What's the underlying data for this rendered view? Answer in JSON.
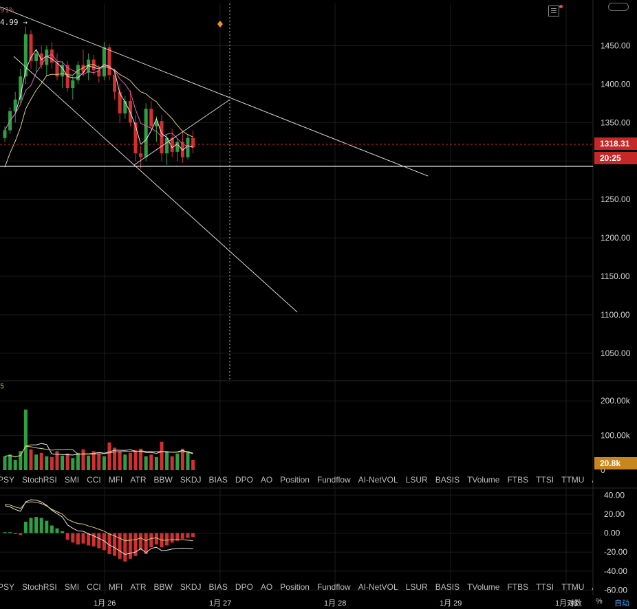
{
  "chart_data": [
    {
      "type": "candlestick",
      "panel": "price",
      "ylim": [
        1015,
        1505
      ],
      "y_ticks": [
        "1450.00",
        "1400.00",
        "1350.00",
        "1300.00",
        "1250.00",
        "1200.00",
        "1150.00",
        "1100.00",
        "1050.00"
      ],
      "y_tick_values": [
        1450,
        1400,
        1350,
        1300,
        1250,
        1200,
        1150,
        1100,
        1050
      ],
      "x_ticks": [
        "1月 26",
        "1月 27",
        "1月 28",
        "1月 29",
        "1月 30"
      ],
      "last_price": "1318.31",
      "countdown": "20:25",
      "top_left_pct": "91%",
      "top_left_price": "4.99 →",
      "candles": [
        [
          1330,
          1345,
          1325,
          1340
        ],
        [
          1340,
          1370,
          1335,
          1365
        ],
        [
          1365,
          1390,
          1350,
          1380
        ],
        [
          1380,
          1420,
          1375,
          1410
        ],
        [
          1410,
          1475,
          1400,
          1465
        ],
        [
          1465,
          1470,
          1420,
          1430
        ],
        [
          1430,
          1445,
          1415,
          1440
        ],
        [
          1440,
          1450,
          1420,
          1425
        ],
        [
          1425,
          1450,
          1410,
          1445
        ],
        [
          1445,
          1455,
          1420,
          1428
        ],
        [
          1428,
          1440,
          1405,
          1410
        ],
        [
          1410,
          1430,
          1395,
          1425
        ],
        [
          1425,
          1430,
          1390,
          1395
        ],
        [
          1395,
          1410,
          1380,
          1405
        ],
        [
          1405,
          1430,
          1400,
          1425
        ],
        [
          1425,
          1445,
          1410,
          1415
        ],
        [
          1415,
          1440,
          1405,
          1432
        ],
        [
          1432,
          1438,
          1412,
          1418
        ],
        [
          1418,
          1425,
          1402,
          1410
        ],
        [
          1410,
          1455,
          1405,
          1448
        ],
        [
          1448,
          1452,
          1405,
          1412
        ],
        [
          1412,
          1420,
          1380,
          1390
        ],
        [
          1390,
          1400,
          1350,
          1362
        ],
        [
          1362,
          1385,
          1355,
          1378
        ],
        [
          1378,
          1392,
          1345,
          1350
        ],
        [
          1350,
          1360,
          1300,
          1310
        ],
        [
          1310,
          1320,
          1290,
          1305
        ],
        [
          1305,
          1375,
          1300,
          1368
        ],
        [
          1368,
          1378,
          1340,
          1345
        ],
        [
          1345,
          1358,
          1325,
          1352
        ],
        [
          1352,
          1360,
          1300,
          1310
        ],
        [
          1310,
          1335,
          1295,
          1330
        ],
        [
          1330,
          1342,
          1305,
          1312
        ],
        [
          1312,
          1330,
          1300,
          1325
        ],
        [
          1325,
          1338,
          1298,
          1305
        ],
        [
          1305,
          1335,
          1302,
          1330
        ],
        [
          1330,
          1340,
          1310,
          1318
        ]
      ]
    },
    {
      "type": "bar",
      "panel": "volume",
      "ylim": [
        0,
        250000
      ],
      "y_ticks": [
        "200.00k",
        "100.00k",
        "0"
      ],
      "y_tick_values": [
        200000,
        100000,
        0
      ],
      "current_volume": "20.8k",
      "corner_label": "5",
      "values": [
        40000,
        45000,
        30000,
        55000,
        175000,
        60000,
        45000,
        50000,
        40000,
        38000,
        55000,
        42000,
        48000,
        35000,
        50000,
        60000,
        42000,
        55000,
        48000,
        40000,
        80000,
        65000,
        55000,
        45000,
        50000,
        58000,
        62000,
        40000,
        45000,
        38000,
        82000,
        55000,
        40000,
        48000,
        62000,
        55000,
        30000
      ]
    },
    {
      "type": "bar",
      "panel": "oscillator",
      "ylim": [
        -64,
        46
      ],
      "y_ticks": [
        "40.00",
        "20.00",
        "0.00",
        "-20.00",
        "-40.00",
        "-60.00"
      ],
      "y_tick_values": [
        40,
        20,
        0,
        -20,
        -40,
        -60
      ],
      "histogram": [
        1,
        1,
        -1,
        -2,
        12,
        16,
        17,
        16,
        13,
        8,
        5,
        2,
        -7,
        -10,
        -12,
        -11,
        -13,
        -14,
        -16,
        -18,
        -22,
        -24,
        -27,
        -30,
        -27,
        -24,
        -18,
        -22,
        -15,
        -12,
        -15,
        -13,
        -10,
        -8,
        -6,
        -5,
        -4
      ]
    }
  ],
  "tabs": [
    "PSY",
    "StochRSI",
    "SMI",
    "CCI",
    "MFI",
    "ATR",
    "BBW",
    "SKDJ",
    "BIAS",
    "DPO",
    "AO",
    "Position",
    "Fundflow",
    "AI-NetVOL",
    "LSUR",
    "BASIS",
    "TVolume",
    "FTBS",
    "TTSI",
    "TTMU",
    "AI-BSI"
  ],
  "bottom": {
    "pct": "%",
    "auto": "自动",
    "log_label": "对数"
  },
  "colors": {
    "up": "#2ea043",
    "down": "#d32f2f",
    "ma_pink": "#e060c0",
    "ma_yellow": "#e0d070",
    "ma_white": "#e8e8e8",
    "grid": "#1c1c1c",
    "last_price": "#c62828",
    "volume_tag": "#c8861e",
    "marker": "#f0902a"
  }
}
